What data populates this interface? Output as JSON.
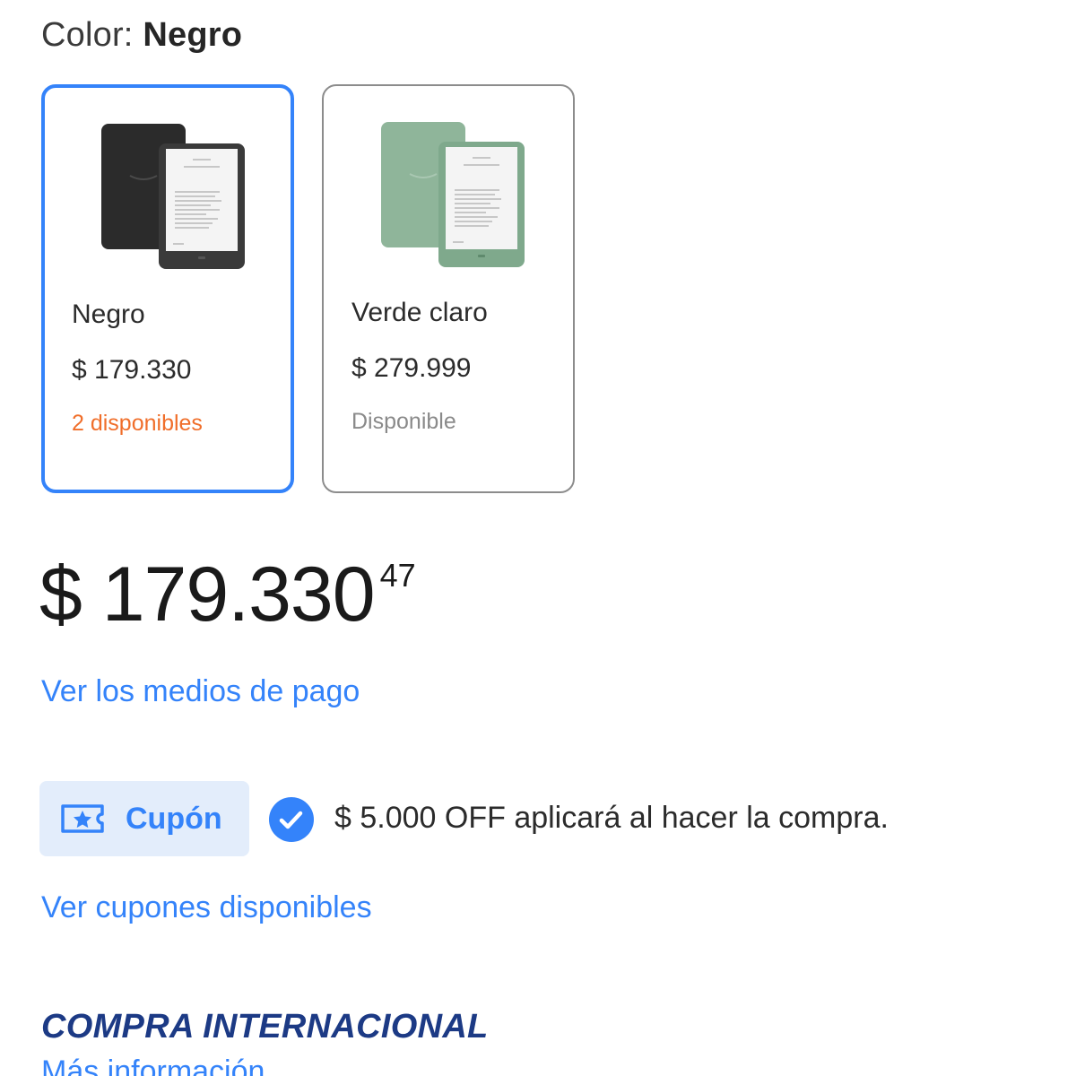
{
  "color_selector": {
    "label": "Color:",
    "selected_value": "Negro"
  },
  "variants": [
    {
      "name": "Negro",
      "price": "$ 179.330",
      "stock": "2 disponibles",
      "selected": true,
      "device_color": "#2e2e2e"
    },
    {
      "name": "Verde claro",
      "price": "$ 279.999",
      "stock": "Disponible",
      "selected": false,
      "device_color": "#8fb59a"
    }
  ],
  "price": {
    "main": "$ 179.330",
    "cents": "47"
  },
  "payment_link": "Ver los medios de pago",
  "coupon": {
    "pill_label": "Cupón",
    "pill_icon": "ticket-star-icon",
    "status_icon": "check-circle-icon",
    "description": "$ 5.000 OFF aplicará al hacer la compra.",
    "see_more_link": "Ver cupones disponibles"
  },
  "international": {
    "title": "COMPRA INTERNACIONAL",
    "more_info_link": "Más información"
  },
  "colors": {
    "accent": "#3483fa",
    "low_stock": "#f06e2a",
    "coupon_bg": "#e3edfb",
    "international_title": "#1c3a85"
  }
}
